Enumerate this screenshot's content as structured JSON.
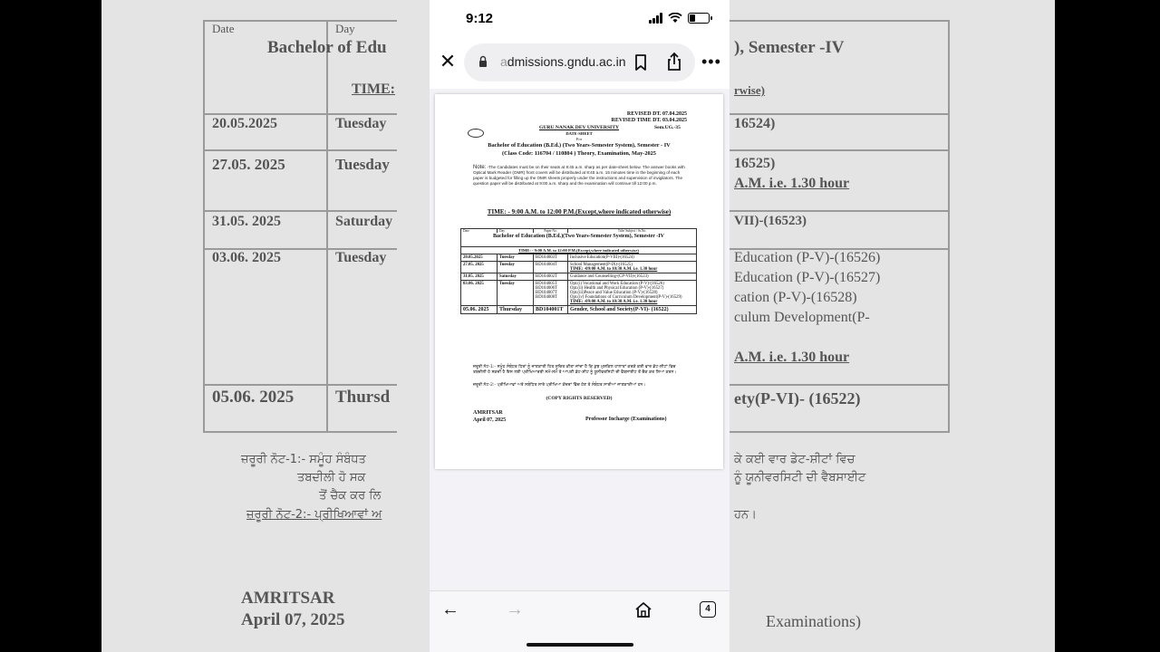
{
  "status_bar": {
    "time": "9:12"
  },
  "browser": {
    "url_faded": "a",
    "url_text": "dmissions.gndu.ac.in",
    "tab_count": "4"
  },
  "document": {
    "revised_date": "REVISED DT. 07.04.2025",
    "revised_time": "REVISED TIME DT. 03.04.2025",
    "university": "GURU NANAK DEV UNIVERSITY",
    "sem_code": "Sem.UG.-35",
    "date_sheet": "DATE-SHEET",
    "for": "For",
    "program": "Bachelor of Education (B.Ed.) (Two Years-Semester System), Semester - IV",
    "class_code": "(Class Code: 116704 / 110804  ) Theory, Examination, May-2025",
    "note_label": "Note:",
    "note_text": "-The Candidates must be on their seats at 8:45 a.m. sharp as per date-sheet below. The answer books with Optical Mark Reader (OMR) front covers will be distributed at 8:45 a.m. 15 minutes time in the beginning of each paper is budgeted for filling up the OMR sheets properly under the instructions and supervision of invigilators. The question paper will be distributed at 9:00 a.m. sharp and the examination will continue till 12:00 p.m.",
    "time_line": "TIME: - 9:00 A.M. to 12:00 P.M.(Except,where indicated otherwise)",
    "table": {
      "headers": [
        "Date",
        "Day",
        "Paper No.",
        "Title/ Subject / Sr.No."
      ],
      "title": "Bachelor of Education (B.Ed.)(Two Years-Semester System), Semester -IV",
      "time": "TIME: - 9:00 A.M. to 12:00 P.M.(Except,where indicated otherwise)",
      "rows": [
        {
          "date": "20.05.2025",
          "day": "Tuesday",
          "paper": "BD104003T",
          "title": "Inclusive Education(P-VIII)-(16524)",
          "extra": ""
        },
        {
          "date": "27.05. 2025",
          "day": "Tuesday",
          "paper": "BD104004T",
          "title": "School  Management(P-IX)-(16525)",
          "extra": "TIME: -09:00 A.M. to 10:30 A.M. i.e. 1.30 hour"
        },
        {
          "date": "31.05. 2025",
          "day": "Saturday",
          "paper": "BD104002T",
          "title": "Guidance and Counselling-(CP-VII)-(16523)",
          "extra": ""
        },
        {
          "date": "03.06. 2025",
          "day": "Tuesday",
          "papers": [
            "BD104005T",
            "BD104006T",
            "BD104007T",
            "BD104008T"
          ],
          "options": [
            "Opt.(i) Vocational and Work Education (P-V)-(16526)",
            "Opt.(ii) Health and Physical Education (P-V)-(16527)",
            "Opt.(iii)Peace and Value Education (P-V)-(16528)",
            "Opt.(iv) Foundations of Curriculum Development(P-V)-(16529)"
          ],
          "extra": "TIME: -09:00 A.M. to 10:30 A.M. i.e. 1.30 hour"
        },
        {
          "date": "05.06. 2025",
          "day": "Thursday",
          "paper": "BD104001T",
          "title": "Gender, School and Society(P-VI)- (16522)",
          "extra": ""
        }
      ]
    },
    "punjabi_note_1": "ਜ਼ਰੂਰੀ ਨੋਟ-1:- ਸਮੂੰਹ ਸੰਬੰਧਤ ਧਿਰਾਂ ਨੂੰ ਜਾਣਕਾਰੀ ਹਿਤ ਸੂਚਿਤ ਕੀਤਾ ਜਾਂਦਾ ਹੈ ਕਿ ਕੁਝ ਮੁਸ਼ਕਿਲ ਹਾਲਾਤਾਂ ਕਰਕੇ ਕਈ ਵਾਰ ਡੇਟ-ਸ਼ੀਟਾਂ ਵਿਚ ਤਬਦੀਲੀ ਹੋ ਸਕਦੀ ਹੈ ਇਸ ਲਈ ਪ੍ਰੀਖਿਆਰਥੀ ਸਮੇਂ-ਸਮੇਂ ਤੇ ਆਪਣੀ ਡੇਟ-ਸ਼ੀਟ ਨੂੰ ਯੂਨੀਵਰਸਿਟੀ ਦੀ ਵੈਬਸਾਈਟ ਤੋਂ ਚੈਕ ਕਰ ਲਿਆ ਕਰਨ।",
    "punjabi_note_2": "ਜ਼ਰੂਰੀ ਨੋਟ-2:- ਪ੍ਰੀਖਿਆਵਾਂ ਅਤੇ ਸਬੰਧਿਤ ਸਾਰੇ ਪ੍ਰੀਖਿਆ ਕੇਂਦਰਾਂ ਵਿੱਚ ਹੋਣ ਤੋ ਸੰਬੰਧਤ ਸਾਰੀਆਂ ਜਾਣਕਾਰੀਆਂ ਹਨ।",
    "copyright": "(COPY RIGHTS RESERVED)",
    "city": "AMRITSAR",
    "date": "April 07, 2025",
    "signatory": "Professor Incharge (Examinations)"
  },
  "backdrop": {
    "left": {
      "hdr_date": "Date",
      "hdr_day": "Day",
      "title": "Bachelor of Edu",
      "time": "TIME:",
      "rows": [
        {
          "date": "20.05.2025",
          "day": "Tuesday"
        },
        {
          "date": "27.05. 2025",
          "day": "Tuesday"
        },
        {
          "date": "31.05. 2025",
          "day": "Saturday"
        },
        {
          "date": "03.06. 2025",
          "day": "Tuesday"
        },
        {
          "date": "05.06. 2025",
          "day": "Thursd"
        }
      ],
      "note1": "ਜ਼ਰੂਰੀ ਨੋਟ-1:- ਸਮੂੰਹ ਸੰਬੰਧਤ",
      "note1b": "ਤਬਦੀਲੀ ਹੋ ਸਕ",
      "note1c": "ਤੋਂ ਚੈਕ ਕਰ ਲਿ",
      "note2": "ਜ਼ਰੂਰੀ ਨੋਟ-2:- ਪ੍ਰੀਖਿਆਵਾਂ ਅ",
      "city": "AMRITSAR",
      "date": "April 07, 2025"
    },
    "right": {
      "title": "), Semester -IV",
      "time": "rwise)",
      "r1": "16524)",
      "r2": "16525)",
      "r2b": "A.M. i.e. 1.30 hour",
      "r3": "VII)-(16523)",
      "r4a": "Education (P-V)-(16526)",
      "r4b": "Education (P-V)-(16527)",
      "r4c": "cation (P-V)-(16528)",
      "r4d": "culum Development(P-",
      "r4e": "A.M. i.e. 1.30 hour",
      "r5": "ety(P-VI)- (16522)",
      "note1": "ਕੇ ਕਈ ਵਾਰ ਡੇਟ-ਸ਼ੀਟਾਂ  ਵਿਚ",
      "note1b": "ਨੂੰ ਯੂਨੀਵਰਸਿਟੀ ਦੀ ਵੈਬਸਾਈਟ",
      "note2": "ਹਨ।",
      "sign": "Examinations)"
    }
  }
}
